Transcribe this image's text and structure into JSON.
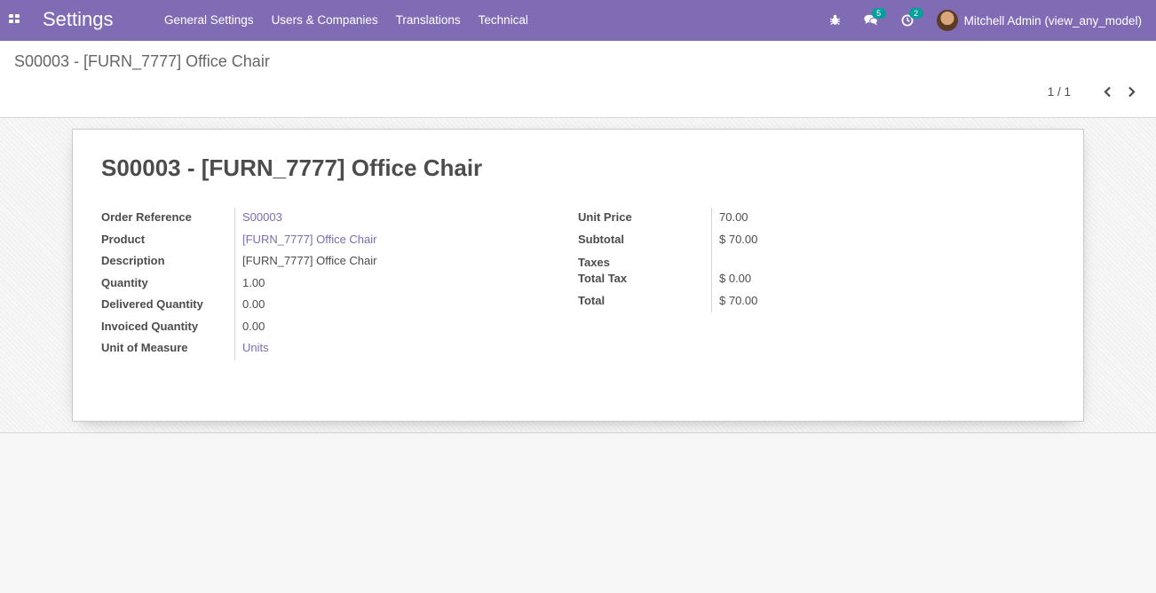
{
  "navbar": {
    "app_title": "Settings",
    "menu": [
      "General Settings",
      "Users & Companies",
      "Translations",
      "Technical"
    ],
    "messages_count": "5",
    "activities_count": "2",
    "user_name": "Mitchell Admin (view_any_model)"
  },
  "control_panel": {
    "breadcrumb": "S00003 - [FURN_7777] Office Chair",
    "pager_value": "1 / 1"
  },
  "form": {
    "title": "S00003 - [FURN_7777] Office Chair",
    "left_fields": [
      {
        "label": "Order Reference",
        "value": "S00003"
      },
      {
        "label": "Product",
        "value": "[FURN_7777] Office Chair"
      },
      {
        "label": "Description",
        "value": "[FURN_7777] Office Chair"
      },
      {
        "label": "Quantity",
        "value": "1.00"
      },
      {
        "label": "Delivered Quantity",
        "value": "0.00"
      },
      {
        "label": "Invoiced Quantity",
        "value": "0.00"
      },
      {
        "label": "Unit of Measure",
        "value": "Units"
      }
    ],
    "right_fields": [
      {
        "label": "Unit Price",
        "value": "70.00"
      },
      {
        "label": "Subtotal",
        "value": "$ 70.00"
      },
      {
        "label": "Taxes",
        "value": ""
      },
      {
        "label": "Total Tax",
        "value": "$ 0.00"
      },
      {
        "label": "Total",
        "value": "$ 70.00"
      }
    ]
  },
  "colors": {
    "navbar": "#806cb4",
    "link": "#7c6cb2",
    "badge": "#01a19b"
  }
}
